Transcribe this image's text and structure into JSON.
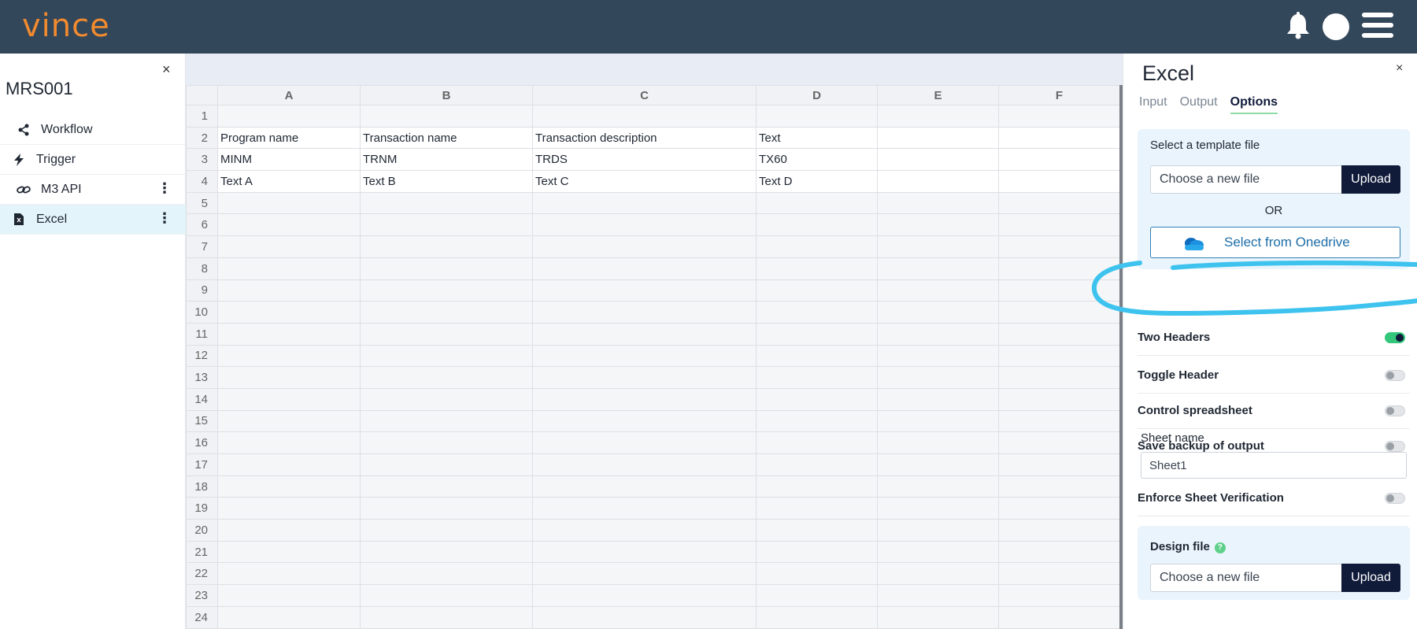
{
  "header": {
    "logo_text": "vince",
    "icons": [
      "bell-icon",
      "avatar",
      "hamburger-menu-icon"
    ]
  },
  "left_panel": {
    "close_symbol": "×",
    "title": "MRS001",
    "items": [
      {
        "label": "Workflow",
        "icon": "workflow-icon"
      },
      {
        "label": "Trigger",
        "icon": "lightning-icon"
      },
      {
        "label": "M3 API",
        "icon": "link-icon",
        "menu": "⋮"
      },
      {
        "label": "Excel",
        "icon": "file-icon",
        "menu": "⋮",
        "active": true
      }
    ]
  },
  "spreadsheet": {
    "columns": [
      "A",
      "B",
      "C",
      "D",
      "E",
      "F"
    ],
    "rows": [
      {
        "num": "1",
        "cells": [
          "",
          "",
          "",
          "",
          "",
          ""
        ]
      },
      {
        "num": "2",
        "cells": [
          "Program name",
          "Transaction name",
          "Transaction description",
          "Text",
          "",
          ""
        ]
      },
      {
        "num": "3",
        "cells": [
          "MINM",
          "TRNM",
          "TRDS",
          "TX60",
          "",
          ""
        ]
      },
      {
        "num": "4",
        "cells": [
          "Text A",
          "Text B",
          "Text C",
          "Text D",
          "",
          ""
        ]
      },
      {
        "num": "5",
        "cells": [
          "",
          "",
          "",
          "",
          "",
          ""
        ]
      },
      {
        "num": "6",
        "cells": [
          "",
          "",
          "",
          "",
          "",
          ""
        ]
      },
      {
        "num": "7",
        "cells": [
          "",
          "",
          "",
          "",
          "",
          ""
        ]
      },
      {
        "num": "8",
        "cells": [
          "",
          "",
          "",
          "",
          "",
          ""
        ]
      },
      {
        "num": "9",
        "cells": [
          "",
          "",
          "",
          "",
          "",
          ""
        ]
      },
      {
        "num": "10",
        "cells": [
          "",
          "",
          "",
          "",
          "",
          ""
        ]
      },
      {
        "num": "11",
        "cells": [
          "",
          "",
          "",
          "",
          "",
          ""
        ]
      },
      {
        "num": "12",
        "cells": [
          "",
          "",
          "",
          "",
          "",
          ""
        ]
      },
      {
        "num": "13",
        "cells": [
          "",
          "",
          "",
          "",
          "",
          ""
        ]
      },
      {
        "num": "14",
        "cells": [
          "",
          "",
          "",
          "",
          "",
          ""
        ]
      },
      {
        "num": "15",
        "cells": [
          "",
          "",
          "",
          "",
          "",
          ""
        ]
      },
      {
        "num": "16",
        "cells": [
          "",
          "",
          "",
          "",
          "",
          ""
        ]
      },
      {
        "num": "17",
        "cells": [
          "",
          "",
          "",
          "",
          "",
          ""
        ]
      },
      {
        "num": "18",
        "cells": [
          "",
          "",
          "",
          "",
          "",
          ""
        ]
      },
      {
        "num": "19",
        "cells": [
          "",
          "",
          "",
          "",
          "",
          ""
        ]
      },
      {
        "num": "20",
        "cells": [
          "",
          "",
          "",
          "",
          "",
          ""
        ]
      },
      {
        "num": "21",
        "cells": [
          "",
          "",
          "",
          "",
          "",
          ""
        ]
      },
      {
        "num": "22",
        "cells": [
          "",
          "",
          "",
          "",
          "",
          ""
        ]
      },
      {
        "num": "23",
        "cells": [
          "",
          "",
          "",
          "",
          "",
          ""
        ]
      },
      {
        "num": "24",
        "cells": [
          "",
          "",
          "",
          "",
          "",
          ""
        ]
      }
    ]
  },
  "right_panel": {
    "title": "Excel",
    "close_symbol": "×",
    "tabs": [
      {
        "label": "Input",
        "active": false
      },
      {
        "label": "Output",
        "active": false
      },
      {
        "label": "Options",
        "active": true
      }
    ],
    "template": {
      "label": "Select a template file",
      "file_placeholder": "Choose a new file",
      "upload_label": "Upload",
      "or_label": "OR",
      "onedrive_label": "Select from Onedrive"
    },
    "options": [
      {
        "label": "Two Headers",
        "on": true
      },
      {
        "label": "Toggle Header",
        "on": false
      },
      {
        "label": "Control spreadsheet",
        "on": false
      },
      {
        "label": "Save backup of output",
        "on": false
      }
    ],
    "sheet_name": {
      "label": "Sheet name",
      "value": "Sheet1"
    },
    "enforce": {
      "label": "Enforce Sheet Verification",
      "on": false
    },
    "design": {
      "label": "Design file",
      "help_symbol": "?",
      "file_placeholder": "Choose a new file",
      "upload_label": "Upload"
    }
  },
  "colors": {
    "topbar": "#33475b",
    "logo": "#f28a2e",
    "accent_dark": "#101b3a",
    "toggle_on": "#34c77b",
    "highlight_annotation": "#3ec3ee"
  }
}
